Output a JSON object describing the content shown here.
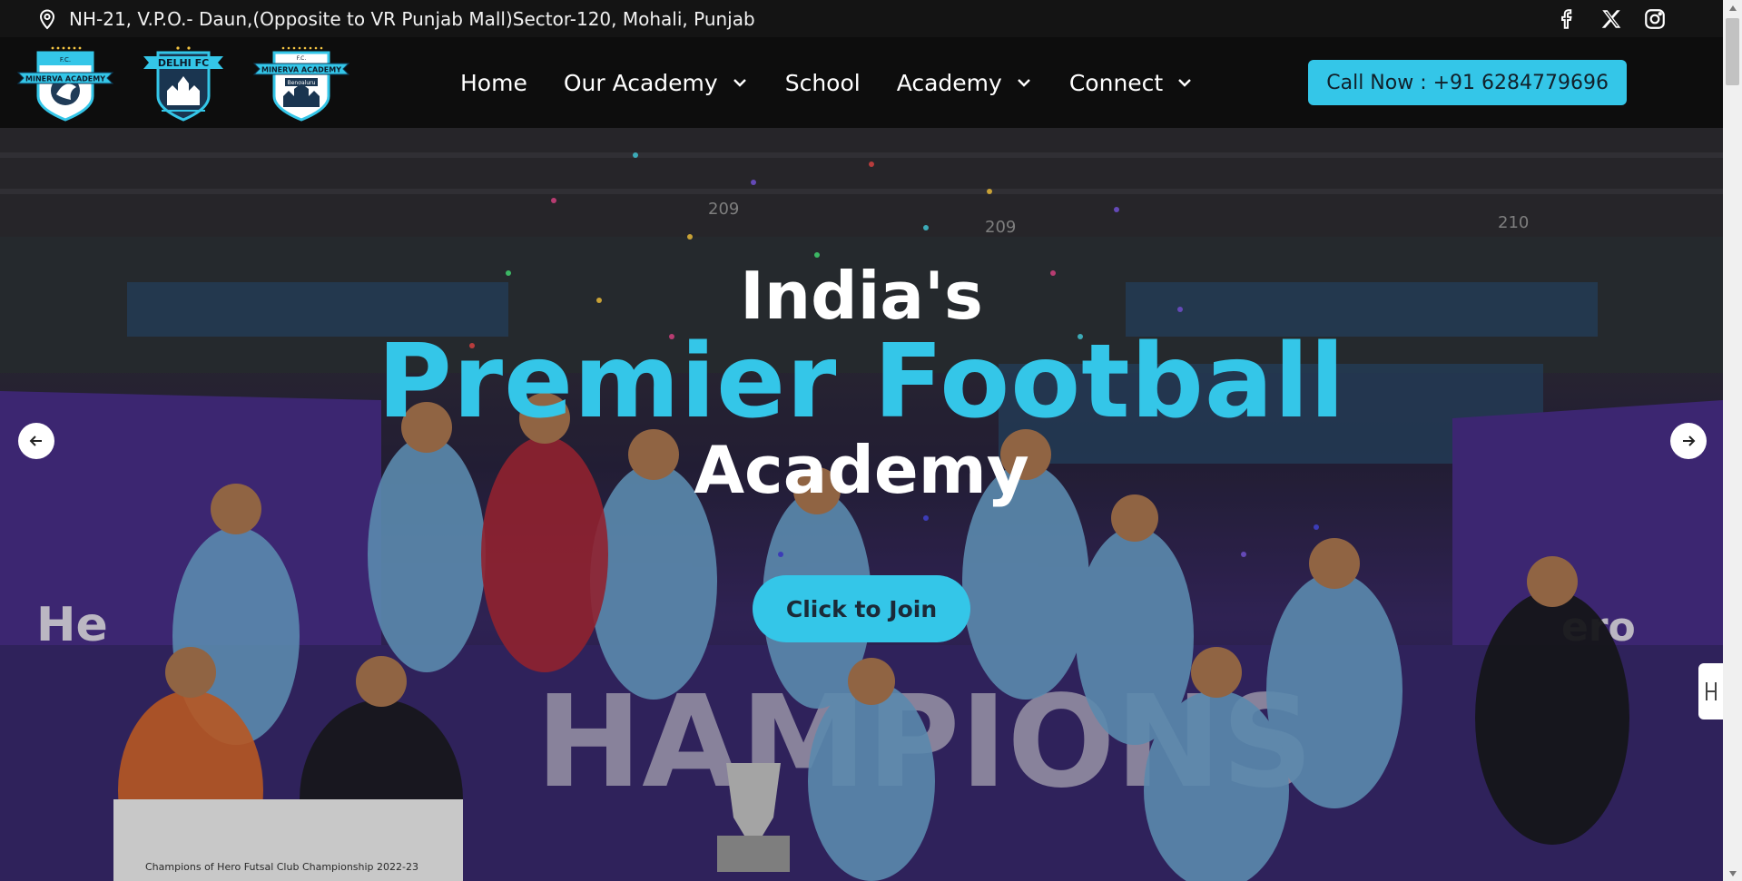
{
  "topbar": {
    "address": "NH-21, V.P.O.- Daun,(Opposite to VR Punjab Mall)Sector-120, Mohali, Punjab",
    "location_icon": "map-pin-icon",
    "social": [
      "facebook-icon",
      "x-twitter-icon",
      "instagram-icon"
    ]
  },
  "logos": [
    {
      "name": "minerva-academy-logo",
      "banner": "MINERVA ACADEMY",
      "top": "F.C."
    },
    {
      "name": "delhi-fc-logo",
      "banner": "DELHI FC"
    },
    {
      "name": "minerva-bengaluru-logo",
      "banner": "MINERVA ACADEMY",
      "sub": "Bengaluru",
      "top": "F.C."
    }
  ],
  "nav": {
    "items": [
      {
        "label": "Home",
        "dropdown": false
      },
      {
        "label": "Our Academy",
        "dropdown": true
      },
      {
        "label": "School",
        "dropdown": false
      },
      {
        "label": "Academy",
        "dropdown": true
      },
      {
        "label": "Connect",
        "dropdown": true
      }
    ],
    "call_label": "Call Now : +91 6284779696"
  },
  "hero": {
    "line1": "India's",
    "line2": "Premier Football",
    "line3": "Academy",
    "join_label": "Click to Join",
    "banner_text": "HAMPIONS",
    "left_sponsor": "He",
    "right_sponsor": "ero",
    "cheque_title": "Champions of Hero Futsal Club Championship  2022-23",
    "seat_numbers": [
      "209",
      "209",
      "210"
    ]
  },
  "colors": {
    "accent": "#34c6e8",
    "topbar": "#141414",
    "navbar": "#0d0d0d"
  }
}
